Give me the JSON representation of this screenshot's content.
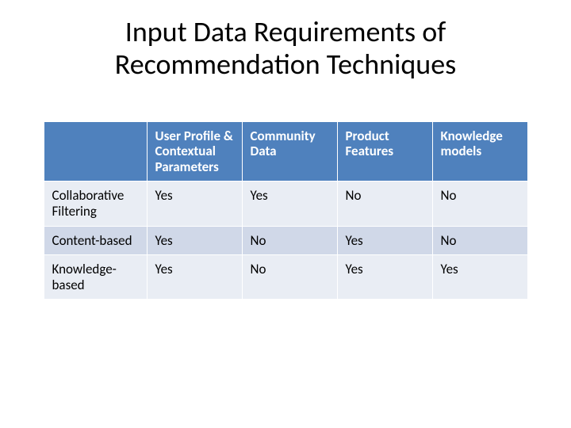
{
  "title": "Input Data Requirements of Recommendation Techniques",
  "columns": [
    "User Profile & Contextual Parameters",
    "Community Data",
    "Product Features",
    "Knowledge models"
  ],
  "rows": [
    {
      "label": "Collaborative Filtering",
      "cells": [
        "Yes",
        "Yes",
        "No",
        "No"
      ]
    },
    {
      "label": "Content-based",
      "cells": [
        "Yes",
        "No",
        "Yes",
        "No"
      ]
    },
    {
      "label": "Knowledge-based",
      "cells": [
        "Yes",
        "No",
        "Yes",
        "Yes"
      ]
    }
  ],
  "chart_data": {
    "type": "table",
    "title": "Input Data Requirements of Recommendation Techniques",
    "columns": [
      "User Profile & Contextual Parameters",
      "Community Data",
      "Product Features",
      "Knowledge models"
    ],
    "row_labels": [
      "Collaborative Filtering",
      "Content-based",
      "Knowledge-based"
    ],
    "values": [
      [
        "Yes",
        "Yes",
        "No",
        "No"
      ],
      [
        "Yes",
        "No",
        "Yes",
        "No"
      ],
      [
        "Yes",
        "No",
        "Yes",
        "Yes"
      ]
    ]
  }
}
